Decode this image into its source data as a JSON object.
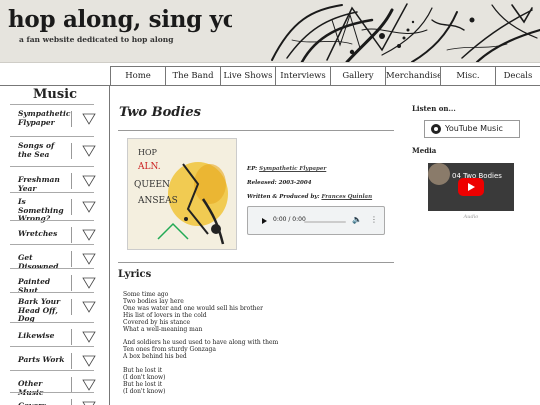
{
  "header": {
    "title": "hop along, sing your song",
    "tagline": "a fan website dedicated to hop along"
  },
  "nav": {
    "items": [
      {
        "label": "Home"
      },
      {
        "label": "The Band"
      },
      {
        "label": "Live Shows"
      },
      {
        "label": "Interviews"
      },
      {
        "label": "Gallery"
      },
      {
        "label": "Merchandise"
      },
      {
        "label": "Misc."
      },
      {
        "label": "Decals"
      }
    ]
  },
  "sidebar": {
    "title": "Music",
    "items": [
      {
        "label": "Sympathetic Flypaper",
        "icon": "triangle-down-icon"
      },
      {
        "label": "Songs of the Sea",
        "icon": "triangle-down-icon"
      },
      {
        "label": "Freshman Year",
        "icon": "triangle-down-icon"
      },
      {
        "label": "Is Something Wrong?",
        "icon": "triangle-down-icon"
      },
      {
        "label": "Wretches",
        "icon": "triangle-down-icon"
      },
      {
        "label": "Get Disowned",
        "icon": "triangle-down-icon"
      },
      {
        "label": "Painted Shut",
        "icon": "triangle-down-icon"
      },
      {
        "label": "Bark Your Head Off, Dog",
        "icon": "triangle-down-icon"
      },
      {
        "label": "Likewise",
        "icon": "triangle-down-icon"
      },
      {
        "label": "Parts Work",
        "icon": "triangle-down-icon"
      },
      {
        "label": "Other Music",
        "icon": "triangle-down-icon"
      },
      {
        "label": "Covers",
        "icon": "triangle-down-icon"
      }
    ]
  },
  "main": {
    "title": "Two Bodies",
    "cover_text": {
      "l1": "HOP",
      "l2": "ALN.",
      "l3": "QUEEN",
      "l4": "ANSEAS"
    },
    "ep_label": "EP:",
    "ep_value": "Sympathetic Flypaper",
    "released_label": "Released:",
    "released_value": "2003-2004",
    "credit_label": "Written & Produced by:",
    "credit_value": "Frances Quinlan",
    "player_time": "0:00 / 0:00",
    "lyrics_title": "Lyrics",
    "lyrics": [
      "Some time ago",
      "Two bodies lay here",
      "One was water and one would sell his brother",
      "His list of lovers in the cold",
      "Covered by his stance",
      "What a well-meaning man",
      "",
      "And soldiers he used used to have along with them",
      "Ten ones from sturdy Gonzaga",
      "A box behind his bed",
      "",
      "But he lost it",
      "(I don't know)",
      "But he lost it",
      "(I don't know)"
    ]
  },
  "right": {
    "listen_label": "Listen on...",
    "yt_music_label": "YouTube Music",
    "media_label": "Media",
    "video_title": "04 Two Bodies",
    "video_caption": "Audio"
  },
  "colors": {
    "accent_red": "#e00000",
    "border": "#777777"
  }
}
